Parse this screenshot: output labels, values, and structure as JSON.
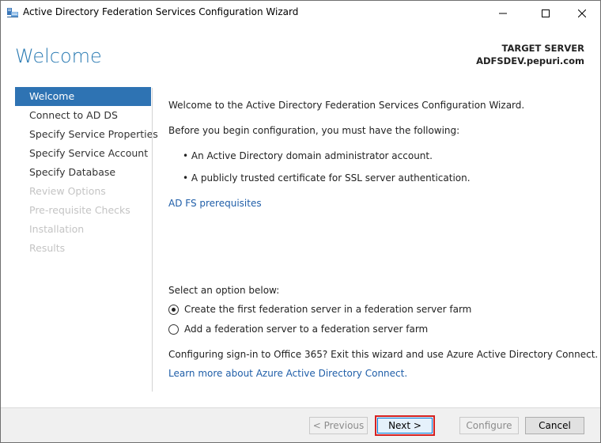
{
  "window": {
    "title": "Active Directory Federation Services Configuration Wizard"
  },
  "header": {
    "page_title": "Welcome",
    "target_label": "TARGET SERVER",
    "target_name": "ADFSDEV.pepuri.com"
  },
  "nav": {
    "items": [
      {
        "label": "Welcome",
        "state": "active"
      },
      {
        "label": "Connect to AD DS",
        "state": "enabled"
      },
      {
        "label": "Specify Service Properties",
        "state": "enabled"
      },
      {
        "label": "Specify Service Account",
        "state": "enabled"
      },
      {
        "label": "Specify Database",
        "state": "enabled"
      },
      {
        "label": "Review Options",
        "state": "disabled"
      },
      {
        "label": "Pre-requisite Checks",
        "state": "disabled"
      },
      {
        "label": "Installation",
        "state": "disabled"
      },
      {
        "label": "Results",
        "state": "disabled"
      }
    ]
  },
  "content": {
    "intro": "Welcome to the Active Directory Federation Services Configuration Wizard.",
    "before": "Before you begin configuration, you must have the following:",
    "bullets": [
      "•  An Active Directory domain administrator account.",
      "•  A publicly trusted certificate for SSL server authentication."
    ],
    "prereq_link": "AD FS prerequisites",
    "select_label": "Select an option below:",
    "options": [
      {
        "label": "Create the first federation server in a federation server farm",
        "selected": true
      },
      {
        "label": "Add a federation server to a federation server farm",
        "selected": false
      }
    ],
    "office_text": "Configuring sign-in to Office 365? Exit this wizard and use Azure Active Directory Connect.",
    "azure_link": "Learn more about Azure Active Directory Connect."
  },
  "footer": {
    "previous": "< Previous",
    "next": "Next >",
    "configure": "Configure",
    "cancel": "Cancel"
  },
  "colors": {
    "accent": "#2e73b3",
    "title_blue": "#2b7bb3",
    "link": "#1f5ea8",
    "highlight_border": "#d42020"
  },
  "icons": {
    "app": "adfs-wizard-icon",
    "minimize": "minimize-icon",
    "maximize": "maximize-icon",
    "close": "close-icon",
    "radio_selected": "radio-selected-icon",
    "radio_unselected": "radio-unselected-icon"
  }
}
